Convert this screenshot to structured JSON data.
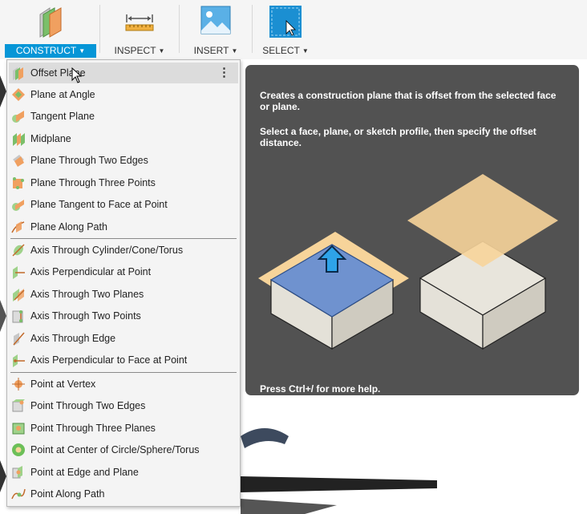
{
  "toolbar": {
    "construct": "CONSTRUCT",
    "inspect": "INSPECT",
    "insert": "INSERT",
    "select": "SELECT"
  },
  "menu": {
    "items": [
      {
        "label": "Offset Plane",
        "icon": "offset-plane-icon"
      },
      {
        "label": "Plane at Angle",
        "icon": "plane-at-angle-icon"
      },
      {
        "label": "Tangent Plane",
        "icon": "tangent-plane-icon"
      },
      {
        "label": "Midplane",
        "icon": "midplane-icon"
      },
      {
        "label": "Plane Through Two Edges",
        "icon": "plane-two-edges-icon"
      },
      {
        "label": "Plane Through Three Points",
        "icon": "plane-three-points-icon"
      },
      {
        "label": "Plane Tangent to Face at Point",
        "icon": "plane-tangent-face-icon"
      },
      {
        "label": "Plane Along Path",
        "icon": "plane-along-path-icon"
      },
      {
        "label": "Axis Through Cylinder/Cone/Torus",
        "icon": "axis-cylinder-icon"
      },
      {
        "label": "Axis Perpendicular at Point",
        "icon": "axis-perpendicular-icon"
      },
      {
        "label": "Axis Through Two Planes",
        "icon": "axis-two-planes-icon"
      },
      {
        "label": "Axis Through Two Points",
        "icon": "axis-two-points-icon"
      },
      {
        "label": "Axis Through Edge",
        "icon": "axis-edge-icon"
      },
      {
        "label": "Axis Perpendicular to Face at Point",
        "icon": "axis-perp-face-icon"
      },
      {
        "label": "Point at Vertex",
        "icon": "point-vertex-icon"
      },
      {
        "label": "Point Through Two Edges",
        "icon": "point-two-edges-icon"
      },
      {
        "label": "Point Through Three Planes",
        "icon": "point-three-planes-icon"
      },
      {
        "label": "Point at Center of Circle/Sphere/Torus",
        "icon": "point-center-icon"
      },
      {
        "label": "Point at Edge and Plane",
        "icon": "point-edge-plane-icon"
      },
      {
        "label": "Point Along Path",
        "icon": "point-along-path-icon"
      }
    ]
  },
  "tooltip": {
    "line1": "Creates a construction plane that is offset from the selected face or plane.",
    "line2": "Select a face, plane, or sketch profile, then specify the offset distance.",
    "footer": "Press Ctrl+/ for more help."
  },
  "colors": {
    "accent": "#0696d7",
    "menu_bg": "#f4f4f4",
    "tooltip_bg": "#525252",
    "plane_orange": "#f7d49a",
    "face_blue": "#6f92cf"
  }
}
